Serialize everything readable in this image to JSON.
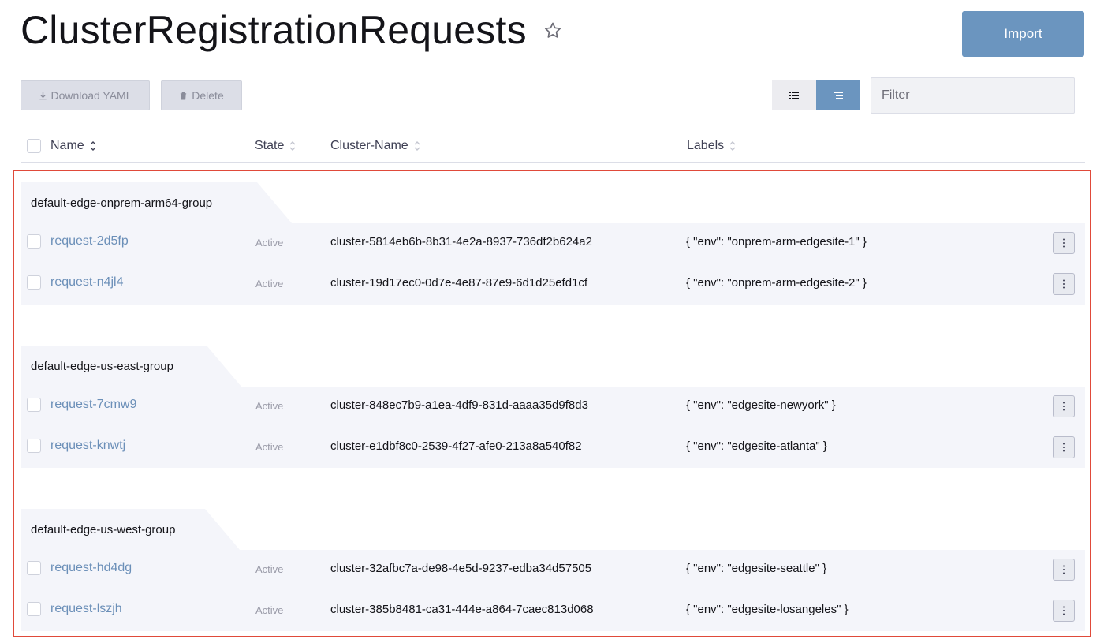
{
  "header": {
    "title": "ClusterRegistrationRequests",
    "import_label": "Import"
  },
  "toolbar": {
    "download_label": "Download YAML",
    "delete_label": "Delete",
    "filter_placeholder": "Filter",
    "filter_value": ""
  },
  "table": {
    "columns": [
      "Name",
      "State",
      "Cluster-Name",
      "Labels"
    ],
    "groups": [
      {
        "name": "default-edge-onprem-arm64-group",
        "rows": [
          {
            "name": "request-2d5fp",
            "state": "Active",
            "cluster": "cluster-5814eb6b-8b31-4e2a-8937-736df2b624a2",
            "labels": "{ \"env\": \"onprem-arm-edgesite-1\" }"
          },
          {
            "name": "request-n4jl4",
            "state": "Active",
            "cluster": "cluster-19d17ec0-0d7e-4e87-87e9-6d1d25efd1cf",
            "labels": "{ \"env\": \"onprem-arm-edgesite-2\" }"
          }
        ]
      },
      {
        "name": "default-edge-us-east-group",
        "rows": [
          {
            "name": "request-7cmw9",
            "state": "Active",
            "cluster": "cluster-848ec7b9-a1ea-4df9-831d-aaaa35d9f8d3",
            "labels": "{ \"env\": \"edgesite-newyork\" }"
          },
          {
            "name": "request-knwtj",
            "state": "Active",
            "cluster": "cluster-e1dbf8c0-2539-4f27-afe0-213a8a540f82",
            "labels": "{ \"env\": \"edgesite-atlanta\" }"
          }
        ]
      },
      {
        "name": "default-edge-us-west-group",
        "rows": [
          {
            "name": "request-hd4dg",
            "state": "Active",
            "cluster": "cluster-32afbc7a-de98-4e5d-9237-edba34d57505",
            "labels": "{ \"env\": \"edgesite-seattle\" }"
          },
          {
            "name": "request-lszjh",
            "state": "Active",
            "cluster": "cluster-385b8481-ca31-444e-a864-7caec813d068",
            "labels": "{ \"env\": \"edgesite-losangeles\" }"
          }
        ]
      }
    ]
  },
  "colors": {
    "accent": "#6b95bf",
    "link": "#6b8fb8",
    "group_bg": "#f4f5fa",
    "highlight_border": "#e04a3a"
  }
}
